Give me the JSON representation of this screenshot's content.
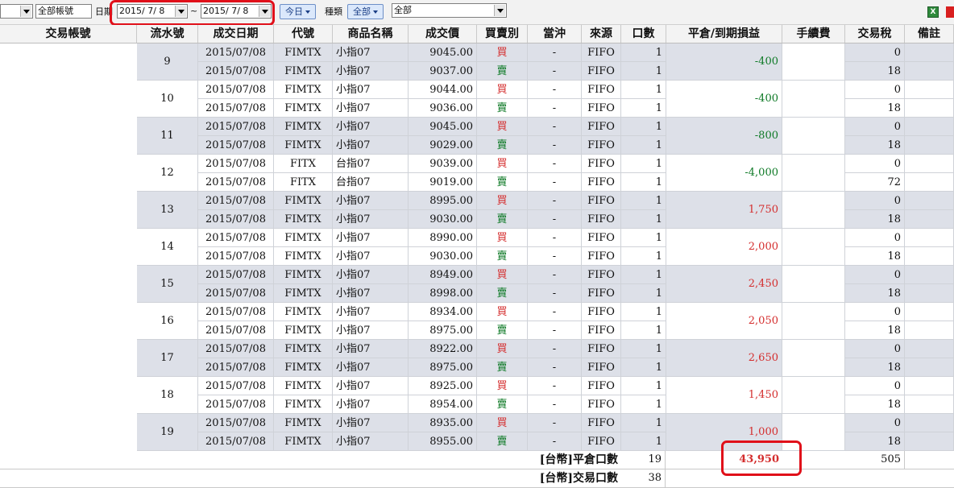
{
  "toolbar": {
    "account_select": "",
    "account_label": "全部帳號",
    "date_label": "日期",
    "date_from": "2015/ 7/ 8",
    "date_sep": "~",
    "date_to": "2015/ 7/ 8",
    "today_button": "今日",
    "type_label": "種類",
    "type_button": "全部",
    "type_select": "全部"
  },
  "columns": [
    "交易帳號",
    "流水號",
    "成交日期",
    "代號",
    "商品名稱",
    "成交價",
    "買賣別",
    "當沖",
    "來源",
    "口數",
    "平倉/到期損益",
    "手續費",
    "交易稅",
    "備註"
  ],
  "groups": [
    {
      "seq": "9",
      "pl": "-400",
      "pl_type": "neg",
      "rows": [
        {
          "date": "2015/07/08",
          "code": "FIMTX",
          "name": "小指07",
          "price": "9045.00",
          "side": "買",
          "side_type": "buy",
          "dt": "-",
          "src": "FIFO",
          "qty": "1",
          "tax": "0"
        },
        {
          "date": "2015/07/08",
          "code": "FIMTX",
          "name": "小指07",
          "price": "9037.00",
          "side": "賣",
          "side_type": "sell",
          "dt": "-",
          "src": "FIFO",
          "qty": "1",
          "tax": "18"
        }
      ]
    },
    {
      "seq": "10",
      "pl": "-400",
      "pl_type": "neg",
      "rows": [
        {
          "date": "2015/07/08",
          "code": "FIMTX",
          "name": "小指07",
          "price": "9044.00",
          "side": "買",
          "side_type": "buy",
          "dt": "-",
          "src": "FIFO",
          "qty": "1",
          "tax": "0"
        },
        {
          "date": "2015/07/08",
          "code": "FIMTX",
          "name": "小指07",
          "price": "9036.00",
          "side": "賣",
          "side_type": "sell",
          "dt": "-",
          "src": "FIFO",
          "qty": "1",
          "tax": "18"
        }
      ]
    },
    {
      "seq": "11",
      "pl": "-800",
      "pl_type": "neg",
      "rows": [
        {
          "date": "2015/07/08",
          "code": "FIMTX",
          "name": "小指07",
          "price": "9045.00",
          "side": "買",
          "side_type": "buy",
          "dt": "-",
          "src": "FIFO",
          "qty": "1",
          "tax": "0"
        },
        {
          "date": "2015/07/08",
          "code": "FIMTX",
          "name": "小指07",
          "price": "9029.00",
          "side": "賣",
          "side_type": "sell",
          "dt": "-",
          "src": "FIFO",
          "qty": "1",
          "tax": "18"
        }
      ]
    },
    {
      "seq": "12",
      "pl": "-4,000",
      "pl_type": "neg",
      "rows": [
        {
          "date": "2015/07/08",
          "code": "FITX",
          "name": "台指07",
          "price": "9039.00",
          "side": "買",
          "side_type": "buy",
          "dt": "-",
          "src": "FIFO",
          "qty": "1",
          "tax": "0"
        },
        {
          "date": "2015/07/08",
          "code": "FITX",
          "name": "台指07",
          "price": "9019.00",
          "side": "賣",
          "side_type": "sell",
          "dt": "-",
          "src": "FIFO",
          "qty": "1",
          "tax": "72"
        }
      ]
    },
    {
      "seq": "13",
      "pl": "1,750",
      "pl_type": "pos",
      "rows": [
        {
          "date": "2015/07/08",
          "code": "FIMTX",
          "name": "小指07",
          "price": "8995.00",
          "side": "買",
          "side_type": "buy",
          "dt": "-",
          "src": "FIFO",
          "qty": "1",
          "tax": "0"
        },
        {
          "date": "2015/07/08",
          "code": "FIMTX",
          "name": "小指07",
          "price": "9030.00",
          "side": "賣",
          "side_type": "sell",
          "dt": "-",
          "src": "FIFO",
          "qty": "1",
          "tax": "18"
        }
      ]
    },
    {
      "seq": "14",
      "pl": "2,000",
      "pl_type": "pos",
      "rows": [
        {
          "date": "2015/07/08",
          "code": "FIMTX",
          "name": "小指07",
          "price": "8990.00",
          "side": "買",
          "side_type": "buy",
          "dt": "-",
          "src": "FIFO",
          "qty": "1",
          "tax": "0"
        },
        {
          "date": "2015/07/08",
          "code": "FIMTX",
          "name": "小指07",
          "price": "9030.00",
          "side": "賣",
          "side_type": "sell",
          "dt": "-",
          "src": "FIFO",
          "qty": "1",
          "tax": "18"
        }
      ]
    },
    {
      "seq": "15",
      "pl": "2,450",
      "pl_type": "pos",
      "rows": [
        {
          "date": "2015/07/08",
          "code": "FIMTX",
          "name": "小指07",
          "price": "8949.00",
          "side": "買",
          "side_type": "buy",
          "dt": "-",
          "src": "FIFO",
          "qty": "1",
          "tax": "0"
        },
        {
          "date": "2015/07/08",
          "code": "FIMTX",
          "name": "小指07",
          "price": "8998.00",
          "side": "賣",
          "side_type": "sell",
          "dt": "-",
          "src": "FIFO",
          "qty": "1",
          "tax": "18"
        }
      ]
    },
    {
      "seq": "16",
      "pl": "2,050",
      "pl_type": "pos",
      "rows": [
        {
          "date": "2015/07/08",
          "code": "FIMTX",
          "name": "小指07",
          "price": "8934.00",
          "side": "買",
          "side_type": "buy",
          "dt": "-",
          "src": "FIFO",
          "qty": "1",
          "tax": "0"
        },
        {
          "date": "2015/07/08",
          "code": "FIMTX",
          "name": "小指07",
          "price": "8975.00",
          "side": "賣",
          "side_type": "sell",
          "dt": "-",
          "src": "FIFO",
          "qty": "1",
          "tax": "18"
        }
      ]
    },
    {
      "seq": "17",
      "pl": "2,650",
      "pl_type": "pos",
      "rows": [
        {
          "date": "2015/07/08",
          "code": "FIMTX",
          "name": "小指07",
          "price": "8922.00",
          "side": "買",
          "side_type": "buy",
          "dt": "-",
          "src": "FIFO",
          "qty": "1",
          "tax": "0"
        },
        {
          "date": "2015/07/08",
          "code": "FIMTX",
          "name": "小指07",
          "price": "8975.00",
          "side": "賣",
          "side_type": "sell",
          "dt": "-",
          "src": "FIFO",
          "qty": "1",
          "tax": "18"
        }
      ]
    },
    {
      "seq": "18",
      "pl": "1,450",
      "pl_type": "pos",
      "rows": [
        {
          "date": "2015/07/08",
          "code": "FIMTX",
          "name": "小指07",
          "price": "8925.00",
          "side": "買",
          "side_type": "buy",
          "dt": "-",
          "src": "FIFO",
          "qty": "1",
          "tax": "0"
        },
        {
          "date": "2015/07/08",
          "code": "FIMTX",
          "name": "小指07",
          "price": "8954.00",
          "side": "賣",
          "side_type": "sell",
          "dt": "-",
          "src": "FIFO",
          "qty": "1",
          "tax": "18"
        }
      ]
    },
    {
      "seq": "19",
      "pl": "1,000",
      "pl_type": "pos",
      "rows": [
        {
          "date": "2015/07/08",
          "code": "FIMTX",
          "name": "小指07",
          "price": "8935.00",
          "side": "買",
          "side_type": "buy",
          "dt": "-",
          "src": "FIFO",
          "qty": "1",
          "tax": "0"
        },
        {
          "date": "2015/07/08",
          "code": "FIMTX",
          "name": "小指07",
          "price": "8955.00",
          "side": "賣",
          "side_type": "sell",
          "dt": "-",
          "src": "FIFO",
          "qty": "1",
          "tax": "18"
        }
      ]
    }
  ],
  "summary": {
    "close_label": "[台幣]平倉口數",
    "close_qty": "19",
    "close_pl": "43,950",
    "close_tax": "505",
    "trade_label": "[台幣]交易口數",
    "trade_qty": "38"
  },
  "colors": {
    "buy": "#d42d2d",
    "sell": "#0f7a27",
    "highlight": "#e0101a",
    "shaded_row": "#dde0e8"
  }
}
